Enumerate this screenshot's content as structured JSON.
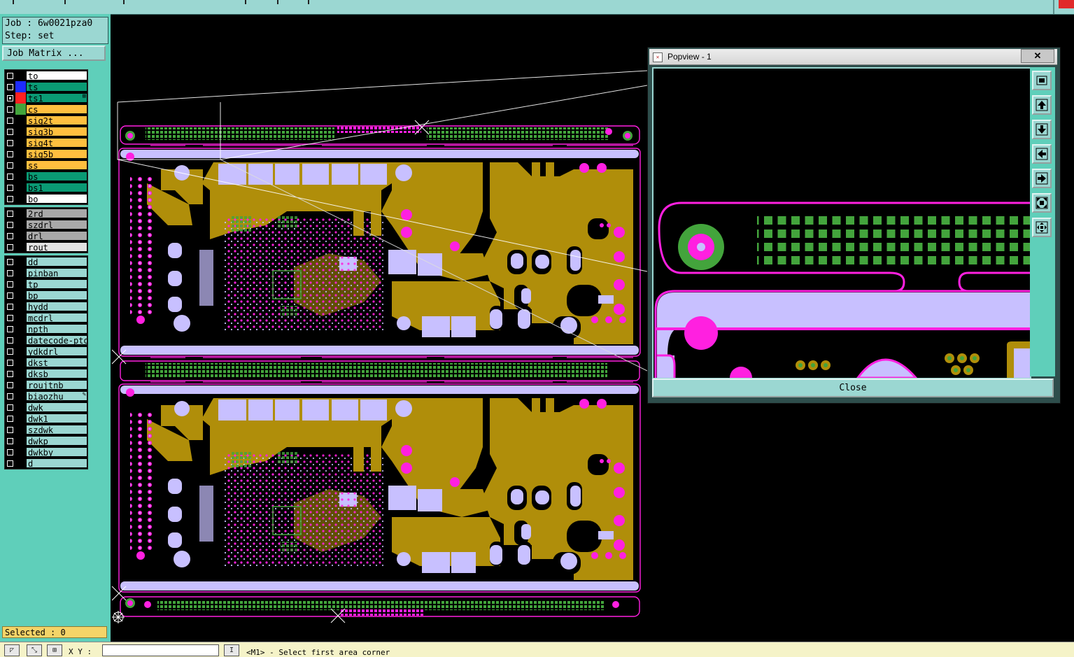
{
  "job": {
    "job_line": "Job : 6w0021pza0",
    "step_line": "Step: set"
  },
  "job_matrix_label": "Job Matrix ...",
  "layer_groups": [
    [
      {
        "name": "to",
        "bg": "#ffffff",
        "swatch": "#000000",
        "checked": false
      },
      {
        "name": "ts",
        "bg": "#0a9a74",
        "swatch": "#1d2bff",
        "checked": false
      },
      {
        "name": "ts1",
        "bg": "#0a9a74",
        "swatch": "#ff2020",
        "checked": true,
        "extra": "⊞"
      },
      {
        "name": "cs",
        "bg": "#ffbf3f",
        "swatch": "#43a43c",
        "checked": false
      },
      {
        "name": "sig2t",
        "bg": "#ffbf3f",
        "swatch": "#000000",
        "checked": false
      },
      {
        "name": "sig3b",
        "bg": "#ffbf3f",
        "swatch": "#000000",
        "checked": false
      },
      {
        "name": "sig4t",
        "bg": "#ffbf3f",
        "swatch": "#000000",
        "checked": false
      },
      {
        "name": "sig5b",
        "bg": "#ffbf3f",
        "swatch": "#000000",
        "checked": false
      },
      {
        "name": "ss",
        "bg": "#ffbf3f",
        "swatch": "#000000",
        "checked": false
      },
      {
        "name": "bs",
        "bg": "#0a9a74",
        "swatch": "#000000",
        "checked": false
      },
      {
        "name": "bs1",
        "bg": "#0a9a74",
        "swatch": "#000000",
        "checked": false
      },
      {
        "name": "bo",
        "bg": "#ffffff",
        "swatch": "#000000",
        "checked": false
      }
    ],
    [
      {
        "name": "2rd",
        "bg": "#a9a9a9",
        "swatch": "#000000",
        "checked": false
      },
      {
        "name": "szdrl",
        "bg": "#a9a9a9",
        "swatch": "#000000",
        "checked": false
      },
      {
        "name": "drl",
        "bg": "#a9a9a9",
        "swatch": "#000000",
        "checked": false
      },
      {
        "name": "rout",
        "bg": "#e2e2e2",
        "swatch": "#000000",
        "checked": false
      }
    ],
    [
      {
        "name": "dd",
        "bg": "#9bd7d2",
        "swatch": "#000000",
        "checked": false
      },
      {
        "name": "pinban",
        "bg": "#9bd7d2",
        "swatch": "#000000",
        "checked": false
      },
      {
        "name": "tp",
        "bg": "#9bd7d2",
        "swatch": "#000000",
        "checked": false
      },
      {
        "name": "bp",
        "bg": "#9bd7d2",
        "swatch": "#000000",
        "checked": false
      },
      {
        "name": "hydd",
        "bg": "#9bd7d2",
        "swatch": "#000000",
        "checked": false
      },
      {
        "name": "mcdrl",
        "bg": "#9bd7d2",
        "swatch": "#000000",
        "checked": false
      },
      {
        "name": "npth",
        "bg": "#9bd7d2",
        "swatch": "#000000",
        "checked": false
      },
      {
        "name": "datecode-pto",
        "bg": "#9bd7d2",
        "swatch": "#000000",
        "checked": false
      },
      {
        "name": "ydkdrl",
        "bg": "#9bd7d2",
        "swatch": "#000000",
        "checked": false
      },
      {
        "name": "dkst",
        "bg": "#9bd7d2",
        "swatch": "#000000",
        "checked": false
      },
      {
        "name": "dksb",
        "bg": "#9bd7d2",
        "swatch": "#000000",
        "checked": false
      },
      {
        "name": "roujtnb",
        "bg": "#9bd7d2",
        "swatch": "#000000",
        "checked": false
      },
      {
        "name": "biaozhu",
        "bg": "#9bd7d2",
        "swatch": "#000000",
        "checked": false,
        "extra": "✎"
      },
      {
        "name": "dwk",
        "bg": "#9bd7d2",
        "swatch": "#000000",
        "checked": false
      },
      {
        "name": "dwk1",
        "bg": "#9bd7d2",
        "swatch": "#000000",
        "checked": false
      },
      {
        "name": "szdwk",
        "bg": "#9bd7d2",
        "swatch": "#000000",
        "checked": false
      },
      {
        "name": "dwkp",
        "bg": "#9bd7d2",
        "swatch": "#000000",
        "checked": false
      },
      {
        "name": "dwkby",
        "bg": "#9bd7d2",
        "swatch": "#000000",
        "checked": false
      },
      {
        "name": "d",
        "bg": "#9bd7d2",
        "swatch": "#000000",
        "checked": false
      }
    ]
  ],
  "status": {
    "selected": "Selected : 0",
    "xy_label": "X Y :",
    "message": "<M1> - Select first area corner"
  },
  "popview": {
    "title": "Popview - 1",
    "close_x": "✕",
    "close_button": "Close",
    "tools": [
      "zoom-home-icon",
      "pan-up-icon",
      "pan-down-icon",
      "pan-left-icon",
      "pan-right-icon",
      "fit-screen-icon",
      "zoom-in-icon"
    ]
  },
  "colors": {
    "copper": "#b08e0a",
    "pad_magenta": "#ff20e0",
    "plane": "#c8c0ff",
    "green": "#43a43c",
    "panel_teal": "#5fcfba"
  }
}
